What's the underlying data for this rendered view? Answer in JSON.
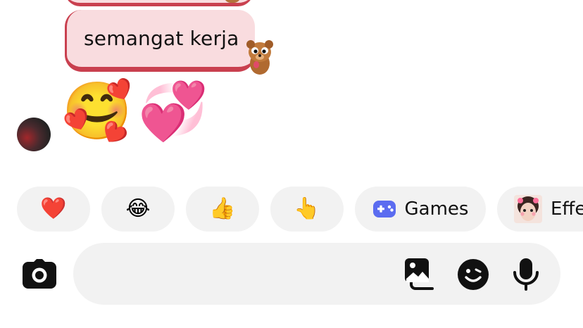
{
  "messages": {
    "outgoing_text": "semangat kerja",
    "incoming_emojis": [
      "🥰",
      "💞"
    ]
  },
  "quick_replies": [
    {
      "emoji": "❤️",
      "label": ""
    },
    {
      "emoji": "😂",
      "label": ""
    },
    {
      "emoji": "👍",
      "label": ""
    },
    {
      "emoji": "👆",
      "label": ""
    },
    {
      "icon": "gamepad-icon",
      "label": "Games",
      "color": "#5b6cf0"
    },
    {
      "icon": "effects-thumbnail",
      "label": "Effe"
    }
  ],
  "composer": {
    "placeholder": "",
    "icons": [
      "camera-icon",
      "gallery-icon",
      "sticker-icon",
      "microphone-icon"
    ]
  },
  "colors": {
    "bubble_bg": "#f9dcdf",
    "bubble_accent": "#c9404f",
    "pill_bg": "#f2f2f2",
    "icon": "#111111"
  }
}
